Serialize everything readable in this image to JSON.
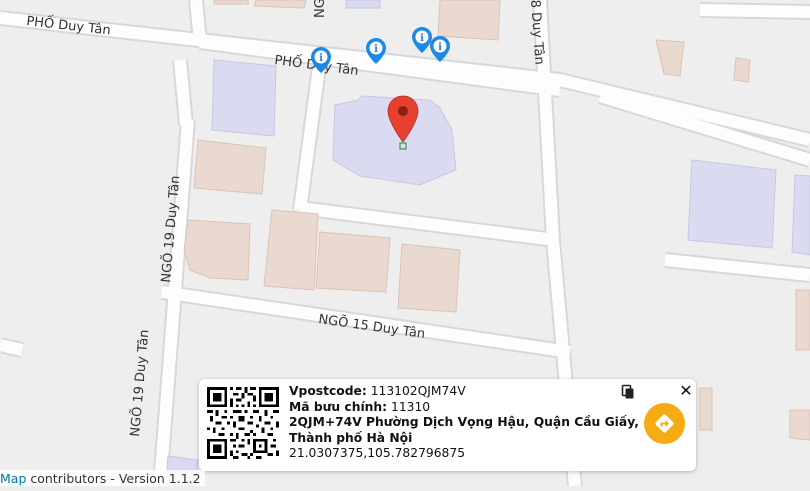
{
  "map": {
    "streets": [
      {
        "id": "pho-duy-tan-west",
        "label": "PHỐ Duy Tân"
      },
      {
        "id": "pho-duy-tan-center",
        "label": "PHỐ Duy Tân"
      },
      {
        "id": "ngo-19-upper",
        "label": "NGÕ 19 Duy Tân"
      },
      {
        "id": "ngo-19-lower",
        "label": "NGÕ 19 Duy Tân"
      },
      {
        "id": "ngo-15",
        "label": "NGÕ 15 Duy Tân"
      },
      {
        "id": "ngo-top",
        "label": "NGÕ"
      },
      {
        "id": "ngo-8",
        "label": "8 Duy Tân"
      }
    ],
    "marker_icon": "map-pin-icon",
    "poi_icon": "info-pin-icon",
    "poi_count": 4,
    "colors": {
      "land": "#eeeeee",
      "road": "#fdfdfd",
      "road_edge": "#d9d9d9",
      "building_blue": "#dadbf0",
      "building_tan": "#ead9cf",
      "marker": "#e8402e",
      "poi": "#1e88e5",
      "direction": "#f7ab12"
    }
  },
  "info_card": {
    "vpostcode_label": "Vpostcode:",
    "vpostcode_value": "113102QJM74V",
    "postal_label": "Mã bưu chính:",
    "postal_value": "11310",
    "address_line1": "2QJM+74V Phường Dịch Vọng Hậu, Quận Cầu Giấy,",
    "address_line2": "Thành phố Hà Nội",
    "coordinates": "21.0307375,105.782796875",
    "copy_icon": "copy-icon",
    "close_label": "✕",
    "directions_icon": "directions-icon"
  },
  "attribution": {
    "link_text": "Map",
    "text": " contributors - Version 1.1.2"
  }
}
